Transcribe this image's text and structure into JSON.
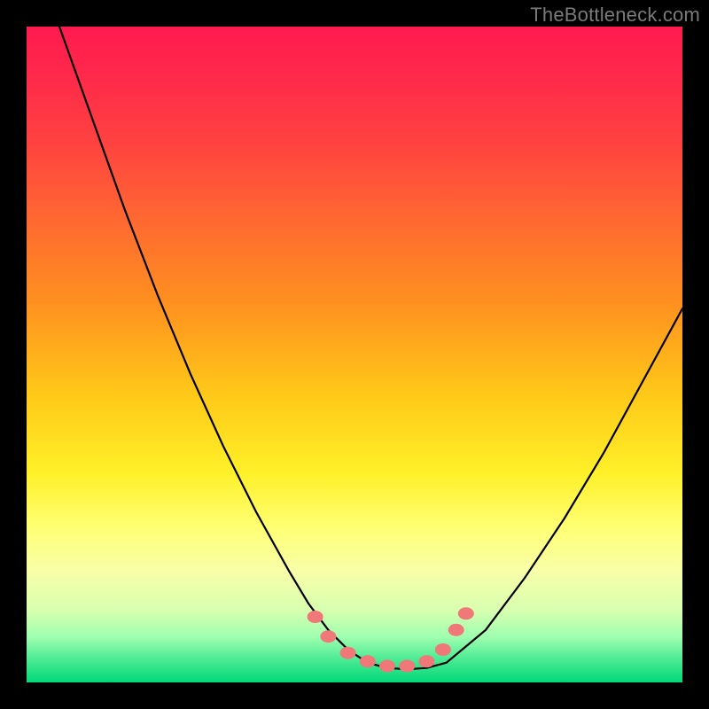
{
  "watermark": {
    "text": "TheBottleneck.com"
  },
  "chart_data": {
    "type": "line",
    "title": "",
    "xlabel": "",
    "ylabel": "",
    "xlim": [
      0,
      100
    ],
    "ylim": [
      0,
      100
    ],
    "background_gradient": {
      "direction": "vertical",
      "stops": [
        {
          "pos": 0,
          "color": "#ff1a50"
        },
        {
          "pos": 50,
          "color": "#ffb020"
        },
        {
          "pos": 78,
          "color": "#ffff60"
        },
        {
          "pos": 100,
          "color": "#00d878"
        }
      ]
    },
    "series": [
      {
        "name": "bottleneck-curve",
        "color": "#000000",
        "x": [
          5,
          10,
          15,
          20,
          25,
          30,
          35,
          40,
          43,
          46,
          49,
          52,
          55,
          58,
          61,
          64,
          70,
          76,
          82,
          88,
          94,
          100
        ],
        "y": [
          100,
          86,
          72,
          59,
          47,
          36,
          26,
          17,
          12,
          8,
          5,
          3,
          2.2,
          2,
          2.2,
          3,
          8,
          16,
          25,
          35,
          46,
          57
        ]
      }
    ],
    "markers": {
      "name": "highlight-dots",
      "color": "#f07878",
      "points": [
        {
          "x": 44,
          "y": 10
        },
        {
          "x": 46,
          "y": 7
        },
        {
          "x": 49,
          "y": 4.5
        },
        {
          "x": 52,
          "y": 3.2
        },
        {
          "x": 55,
          "y": 2.5
        },
        {
          "x": 58,
          "y": 2.5
        },
        {
          "x": 61,
          "y": 3.2
        },
        {
          "x": 63.5,
          "y": 5
        },
        {
          "x": 65.5,
          "y": 8
        },
        {
          "x": 67,
          "y": 10.5
        }
      ]
    }
  }
}
